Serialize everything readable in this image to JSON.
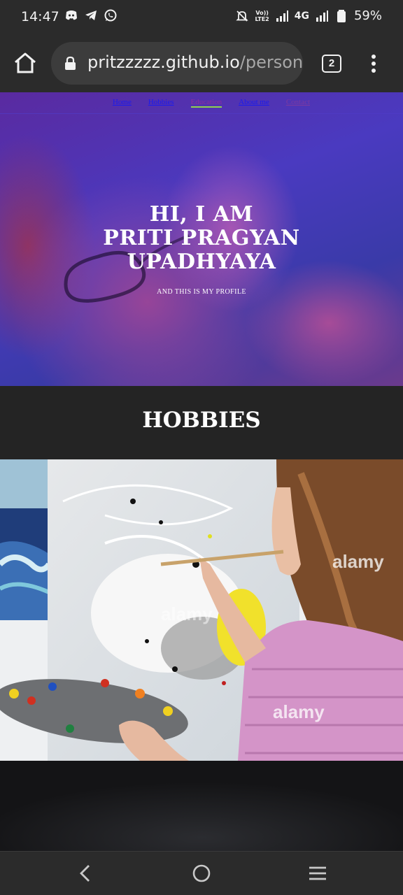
{
  "status_bar": {
    "time": "14:47",
    "network": "4G",
    "volte_line1": "Vo))",
    "volte_line2": "LTE2",
    "battery": "59%"
  },
  "browser": {
    "url_host": "pritzzzzz.github.io",
    "url_path": "/person",
    "tab_count": "2"
  },
  "hero": {
    "nav": [
      {
        "label": "Home"
      },
      {
        "label": "Hobbies"
      },
      {
        "label": "Education"
      },
      {
        "label": "About me"
      },
      {
        "label": "Contact"
      }
    ],
    "title_line1": "HI, I AM",
    "title_line2": "PRITI PRAGYAN",
    "title_line3": "UPADHYAYA",
    "subtitle": "AND THIS IS MY PROFILE"
  },
  "hobbies": {
    "heading": "HOBBIES",
    "watermark": "alamy"
  },
  "colors": {
    "accent_underline": "#8fd14f",
    "link": "#1a1aee"
  }
}
